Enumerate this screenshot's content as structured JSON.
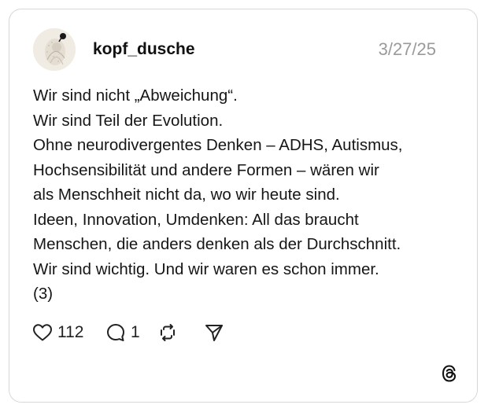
{
  "post": {
    "username": "kopf_dusche",
    "date": "3/27/25",
    "text_lines": [
      "Wir sind nicht „Abweichung“.",
      "Wir sind Teil der Evolution.",
      "Ohne neurodivergentes Denken – ADHS, Autismus,",
      "Hochsensibilität und andere Formen – wären wir",
      "als Menschheit nicht da, wo wir heute sind.",
      "Ideen, Innovation, Umdenken: All das braucht",
      "Menschen, die anders denken als der Durchschnitt.",
      "Wir sind wichtig. Und wir waren es schon immer.",
      "(3)"
    ]
  },
  "actions": {
    "likes": "112",
    "replies": "1",
    "like_icon": "heart-icon",
    "reply_icon": "comment-icon",
    "repost_icon": "repost-icon",
    "share_icon": "send-icon"
  },
  "brand": {
    "logo_icon": "threads-logo-icon"
  }
}
